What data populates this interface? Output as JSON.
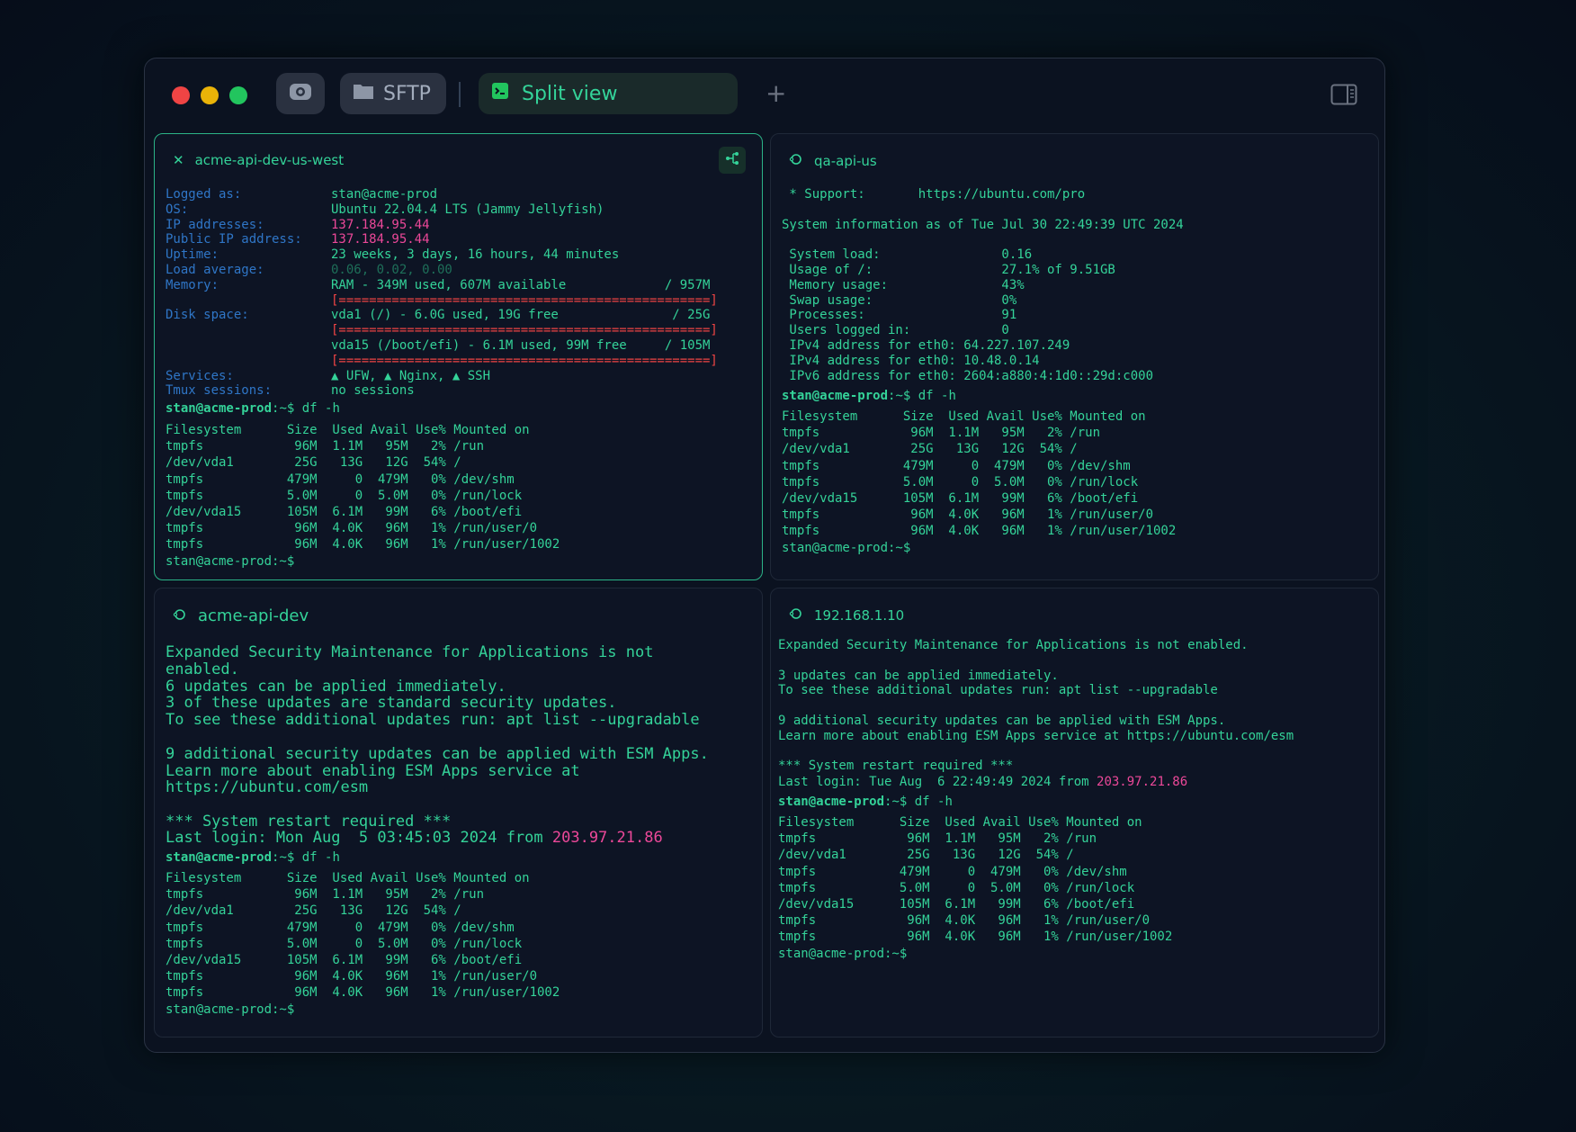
{
  "tabs": {
    "sftp_label": "SFTP",
    "split_label": "Split view",
    "add_label": "+"
  },
  "panes": {
    "top_left": {
      "title": "acme-api-dev-us-west",
      "close": "✕",
      "info_lines": [
        [
          "Logged as:",
          "stan@acme-prod",
          ""
        ],
        [
          "OS:",
          "Ubuntu 22.04.4 LTS (Jammy Jellyfish)",
          ""
        ],
        [
          "IP addresses:",
          "137.184.95.44",
          "pink"
        ],
        [
          "Public IP address:",
          "137.184.95.44",
          "pink"
        ],
        [
          "Uptime:",
          "23 weeks, 3 days, 16 hours, 44 minutes",
          ""
        ],
        [
          "Load average:",
          "0.06, 0.02, 0.00",
          "dim"
        ],
        [
          "Memory:",
          "RAM - 349M used, 607M available             / 957M",
          ""
        ],
        [
          "",
          "[=================================================]",
          "bar"
        ],
        [
          "Disk space:",
          "vda1 (/) - 6.0G used, 19G free               / 25G",
          ""
        ],
        [
          "",
          "[=================================================]",
          "bar"
        ],
        [
          "",
          "vda15 (/boot/efi) - 6.1M used, 99M free     / 105M",
          ""
        ],
        [
          "",
          "[=================================================]",
          "bar"
        ],
        [
          "Services:",
          "▲ UFW, ▲ Nginx, ▲ SSH",
          ""
        ],
        [
          "Tmux sessions:",
          "no sessions",
          ""
        ]
      ],
      "prompt_user": "stan@acme-prod",
      "prompt_rest": ":~$ df -h",
      "df_output": "Filesystem      Size  Used Avail Use% Mounted on\ntmpfs            96M  1.1M   95M   2% /run\n/dev/vda1        25G   13G   12G  54% /\ntmpfs           479M     0  479M   0% /dev/shm\ntmpfs           5.0M     0  5.0M   0% /run/lock\n/dev/vda15      105M  6.1M   99M   6% /boot/efi\ntmpfs            96M  4.0K   96M   1% /run/user/0\ntmpfs            96M  4.0K   96M   1% /run/user/1002\nstan@acme-prod:~$"
    },
    "top_right": {
      "title": "qa-api-us",
      "text_a": " * Support:       https://ubuntu.com/pro\n\nSystem information as of Tue Jul 30 22:49:39 UTC 2024\n\n System load:                0.16\n Usage of /:                 27.1% of 9.51GB\n Memory usage:               43%\n Swap usage:                 0%\n Processes:                  91\n Users logged in:            0\n IPv4 address for eth0: 64.227.107.249\n IPv4 address for eth0: 10.48.0.14\n IPv6 address for eth0: 2604:a880:4:1d0::29d:c000",
      "prompt_user": "stan@acme-prod",
      "prompt_rest": ":~$ df -h",
      "df_output": "Filesystem      Size  Used Avail Use% Mounted on\ntmpfs            96M  1.1M   95M   2% /run\n/dev/vda1        25G   13G   12G  54% /\ntmpfs           479M     0  479M   0% /dev/shm\ntmpfs           5.0M     0  5.0M   0% /run/lock\n/dev/vda15      105M  6.1M   99M   6% /boot/efi\ntmpfs            96M  4.0K   96M   1% /run/user/0\ntmpfs            96M  4.0K   96M   1% /run/user/1002\nstan@acme-prod:~$"
    },
    "bottom_left": {
      "title": "acme-api-dev",
      "text_a": "Expanded Security Maintenance for Applications is not\nenabled.\n6 updates can be applied immediately.\n3 of these updates are standard security updates.\nTo see these additional updates run: apt list --upgradable\n\n9 additional security updates can be applied with ESM Apps.\nLearn more about enabling ESM Apps service at\nhttps://ubuntu.com/esm\n\n*** System restart required ***",
      "last_login": "Last login: Mon Aug  5 03:45:03 2024 from ",
      "last_login_ip": "203.97.21.86",
      "prompt_user": "stan@acme-prod",
      "prompt_rest": ":~$ df -h",
      "df_output": "Filesystem      Size  Used Avail Use% Mounted on\ntmpfs            96M  1.1M   95M   2% /run\n/dev/vda1        25G   13G   12G  54% /\ntmpfs           479M     0  479M   0% /dev/shm\ntmpfs           5.0M     0  5.0M   0% /run/lock\n/dev/vda15      105M  6.1M   99M   6% /boot/efi\ntmpfs            96M  4.0K   96M   1% /run/user/0\ntmpfs            96M  4.0K   96M   1% /run/user/1002\nstan@acme-prod:~$"
    },
    "bottom_right": {
      "title": "192.168.1.10",
      "text_a": "Expanded Security Maintenance for Applications is not enabled.\n\n3 updates can be applied immediately.\nTo see these additional updates run: apt list --upgradable\n\n9 additional security updates can be applied with ESM Apps.\nLearn more about enabling ESM Apps service at https://ubuntu.com/esm\n\n*** System restart required ***",
      "last_login": "Last login: Tue Aug  6 22:49:49 2024 from ",
      "last_login_ip": "203.97.21.86",
      "prompt_user": "stan@acme-prod",
      "prompt_rest": ":~$ df -h",
      "df_output": "Filesystem      Size  Used Avail Use% Mounted on\ntmpfs            96M  1.1M   95M   2% /run\n/dev/vda1        25G   13G   12G  54% /\ntmpfs           479M     0  479M   0% /dev/shm\ntmpfs           5.0M     0  5.0M   0% /run/lock\n/dev/vda15      105M  6.1M   99M   6% /boot/efi\ntmpfs            96M  4.0K   96M   1% /run/user/0\ntmpfs            96M  4.0K   96M   1% /run/user/1002\nstan@acme-prod:~$"
    }
  },
  "colors": {
    "accent": "#34d399",
    "label_blue": "#2f76c7",
    "ip_pink": "#ec4899",
    "bar_red": "#ef4444"
  }
}
